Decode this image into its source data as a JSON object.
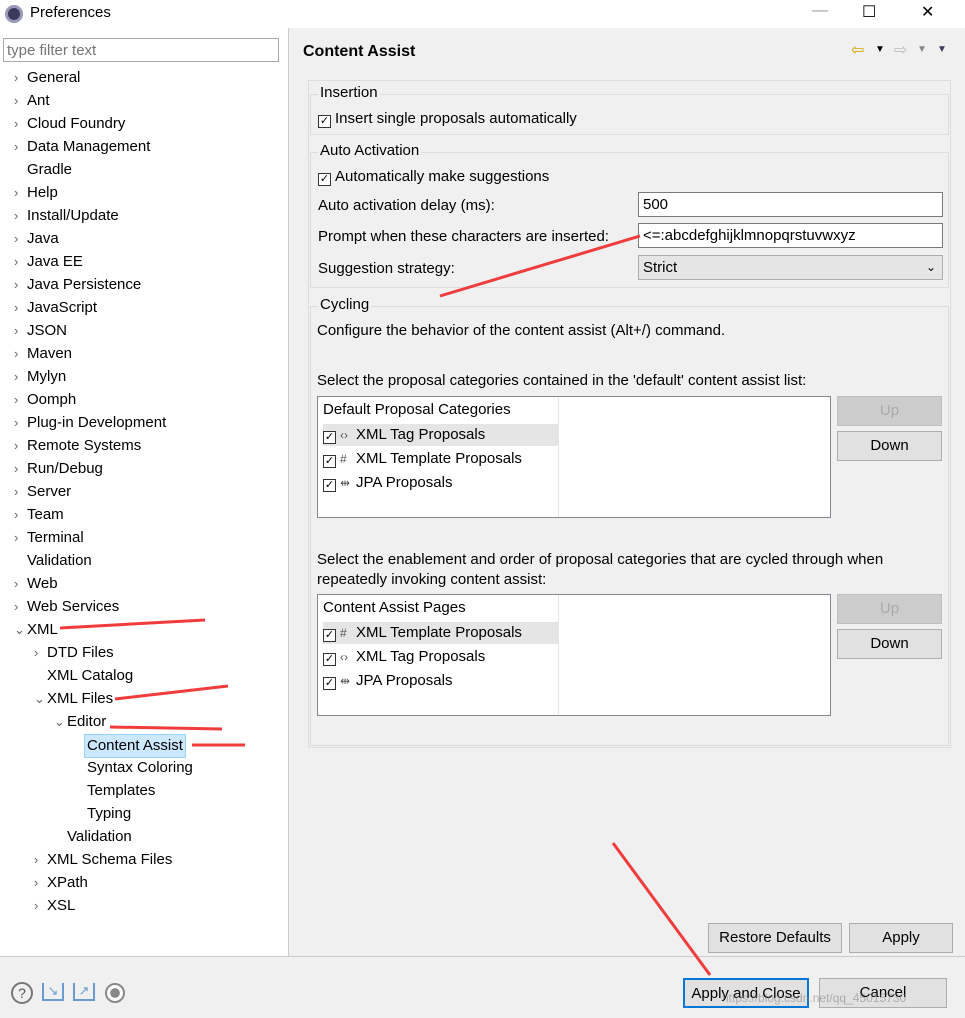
{
  "window": {
    "title": "Preferences",
    "minimize": "—",
    "maximize": "☐",
    "close": "✕"
  },
  "filter": {
    "placeholder": "type filter text"
  },
  "tree": [
    {
      "label": "General",
      "level": 0,
      "chevron": "›"
    },
    {
      "label": "Ant",
      "level": 0,
      "chevron": "›"
    },
    {
      "label": "Cloud Foundry",
      "level": 0,
      "chevron": "›"
    },
    {
      "label": "Data Management",
      "level": 0,
      "chevron": "›"
    },
    {
      "label": "Gradle",
      "level": 0,
      "chevron": ""
    },
    {
      "label": "Help",
      "level": 0,
      "chevron": "›"
    },
    {
      "label": "Install/Update",
      "level": 0,
      "chevron": "›"
    },
    {
      "label": "Java",
      "level": 0,
      "chevron": "›"
    },
    {
      "label": "Java EE",
      "level": 0,
      "chevron": "›"
    },
    {
      "label": "Java Persistence",
      "level": 0,
      "chevron": "›"
    },
    {
      "label": "JavaScript",
      "level": 0,
      "chevron": "›"
    },
    {
      "label": "JSON",
      "level": 0,
      "chevron": "›"
    },
    {
      "label": "Maven",
      "level": 0,
      "chevron": "›"
    },
    {
      "label": "Mylyn",
      "level": 0,
      "chevron": "›"
    },
    {
      "label": "Oomph",
      "level": 0,
      "chevron": "›"
    },
    {
      "label": "Plug-in Development",
      "level": 0,
      "chevron": "›"
    },
    {
      "label": "Remote Systems",
      "level": 0,
      "chevron": "›"
    },
    {
      "label": "Run/Debug",
      "level": 0,
      "chevron": "›"
    },
    {
      "label": "Server",
      "level": 0,
      "chevron": "›"
    },
    {
      "label": "Team",
      "level": 0,
      "chevron": "›"
    },
    {
      "label": "Terminal",
      "level": 0,
      "chevron": "›"
    },
    {
      "label": "Validation",
      "level": 0,
      "chevron": ""
    },
    {
      "label": "Web",
      "level": 0,
      "chevron": "›"
    },
    {
      "label": "Web Services",
      "level": 0,
      "chevron": "›"
    },
    {
      "label": "XML",
      "level": 0,
      "chevron": "⌄"
    },
    {
      "label": "DTD Files",
      "level": 1,
      "chevron": "›"
    },
    {
      "label": "XML Catalog",
      "level": 1,
      "chevron": ""
    },
    {
      "label": "XML Files",
      "level": 1,
      "chevron": "⌄"
    },
    {
      "label": "Editor",
      "level": 2,
      "chevron": "⌄"
    },
    {
      "label": "Content Assist",
      "level": 3,
      "chevron": "",
      "selected": true
    },
    {
      "label": "Syntax Coloring",
      "level": 3,
      "chevron": ""
    },
    {
      "label": "Templates",
      "level": 3,
      "chevron": ""
    },
    {
      "label": "Typing",
      "level": 3,
      "chevron": ""
    },
    {
      "label": "Validation",
      "level": 2,
      "chevron": ""
    },
    {
      "label": "XML Schema Files",
      "level": 1,
      "chevron": "›"
    },
    {
      "label": "XPath",
      "level": 1,
      "chevron": "›"
    },
    {
      "label": "XSL",
      "level": 1,
      "chevron": "›"
    }
  ],
  "page": {
    "title": "Content Assist",
    "nav": {
      "back": "⇦",
      "fwd": "⇨",
      "menu": "▼"
    },
    "insertion": {
      "label": "Insertion",
      "insert_single": "Insert single proposals automatically",
      "insert_single_checked": true
    },
    "auto": {
      "label": "Auto Activation",
      "make_suggestions": "Automatically make suggestions",
      "make_suggestions_checked": true,
      "delay_label": "Auto activation delay (ms):",
      "delay_value": "500",
      "prompt_label": "Prompt when these characters are inserted:",
      "prompt_value": "<=:abcdefghijklmnopqrstuvwxyz",
      "strategy_label": "Suggestion strategy:",
      "strategy_value": "Strict"
    },
    "cycling": {
      "label": "Cycling",
      "desc": "Configure the behavior of the content assist (Alt+/) command.",
      "default_label": "Select the proposal categories contained in the 'default' content assist list:",
      "default_header": "Default Proposal Categories",
      "default_items": [
        {
          "icon": "‹›",
          "label": "XML Tag Proposals",
          "checked": true
        },
        {
          "icon": "#",
          "label": "XML Template Proposals",
          "checked": true
        },
        {
          "icon": "⇹",
          "label": "JPA Proposals",
          "checked": true
        }
      ],
      "cycle_label": "Select the enablement and order of proposal categories that are cycled through when repeatedly invoking content assist:",
      "cycle_header": "Content Assist Pages",
      "cycle_items": [
        {
          "icon": "#",
          "label": "XML Template Proposals",
          "checked": true
        },
        {
          "icon": "‹›",
          "label": "XML Tag Proposals",
          "checked": true
        },
        {
          "icon": "⇹",
          "label": "JPA Proposals",
          "checked": true
        }
      ],
      "up": "Up",
      "down": "Down"
    },
    "restore": "Restore Defaults",
    "apply": "Apply"
  },
  "footer": {
    "apply_close": "Apply and Close",
    "cancel": "Cancel",
    "watermark": "https://blog.csdn.net/qq_45015730"
  },
  "colors": {
    "annotation_arrow": "#f03c3c",
    "selection": "#cce8ff",
    "focus": "#0078d7"
  }
}
